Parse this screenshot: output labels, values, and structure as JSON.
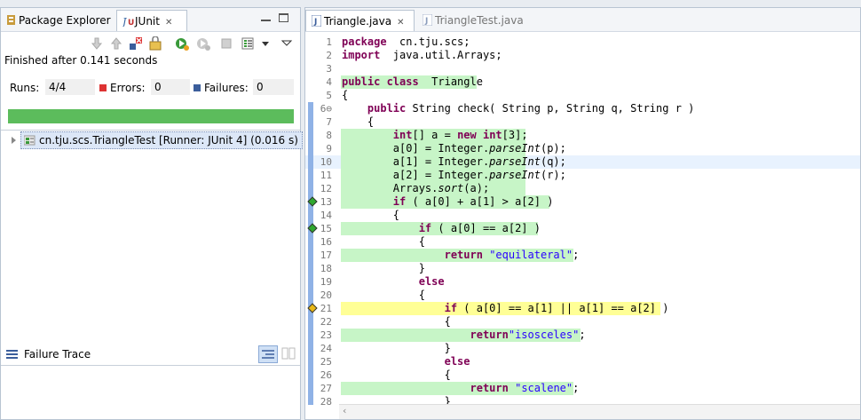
{
  "left_panel": {
    "tabs": [
      {
        "label": "Package Explorer",
        "active": false
      },
      {
        "label": "JUnit",
        "active": true
      }
    ],
    "status_text": "Finished after 0.141 seconds",
    "runs_label": "Runs:",
    "runs_value": "4/4",
    "errors_label": "Errors:",
    "errors_value": "0",
    "failures_label": "Failures:",
    "failures_value": "0",
    "progress_fraction": 1.0,
    "progress_color": "#5cbc5c",
    "test_tree": [
      {
        "label": "cn.tju.scs.TriangleTest [Runner: JUnit 4] (0.016 s)"
      }
    ],
    "failure_trace_label": "Failure Trace"
  },
  "editor": {
    "tabs": [
      {
        "label": "Triangle.java",
        "active": true
      },
      {
        "label": "TriangleTest.java",
        "active": false
      }
    ],
    "coverage_colors": {
      "full": "#c7f5c7",
      "partial": "#ffff96"
    },
    "lines": [
      {
        "n": "1",
        "segs": [
          [
            "kw",
            "package"
          ],
          [
            "",
            "  cn.tju.scs;"
          ]
        ]
      },
      {
        "n": "2",
        "segs": [
          [
            "kw",
            "import"
          ],
          [
            "",
            "  java.util.Arrays;"
          ]
        ]
      },
      {
        "n": "3",
        "segs": []
      },
      {
        "n": "4",
        "cov": "full",
        "covw": 153,
        "segs": [
          [
            "kw",
            "public class"
          ],
          [
            "",
            "  Triangle"
          ]
        ]
      },
      {
        "n": "5",
        "segs": [
          [
            "",
            "{"
          ]
        ]
      },
      {
        "n": "6⊖",
        "ruler": true,
        "segs": [
          [
            "",
            "    "
          ],
          [
            "kw",
            "public"
          ],
          [
            "",
            " String check( String p, String q, String r )"
          ]
        ]
      },
      {
        "n": "7",
        "ruler": true,
        "segs": [
          [
            "",
            "    {"
          ]
        ]
      },
      {
        "n": "8",
        "ruler": true,
        "cov": "full",
        "covw": 208,
        "segs": [
          [
            "",
            "        "
          ],
          [
            "kw",
            "int"
          ],
          [
            "",
            "[] a = "
          ],
          [
            "kw",
            "new"
          ],
          [
            " ",
            " "
          ],
          [
            "kw",
            "int"
          ],
          [
            "",
            "[3];"
          ]
        ]
      },
      {
        "n": "9",
        "ruler": true,
        "cov": "full",
        "covw": 208,
        "segs": [
          [
            "",
            "        a[0] = Integer."
          ],
          [
            "it",
            "parseInt"
          ],
          [
            "",
            "(p);"
          ]
        ]
      },
      {
        "n": "10",
        "ruler": true,
        "cov": "full",
        "covw": 208,
        "current": true,
        "segs": [
          [
            "",
            "        a[1] = Integer."
          ],
          [
            "it",
            "parseInt"
          ],
          [
            "",
            "(q);"
          ]
        ]
      },
      {
        "n": "11",
        "ruler": true,
        "cov": "full",
        "covw": 208,
        "segs": [
          [
            "",
            "        a[2] = Integer."
          ],
          [
            "it",
            "parseInt"
          ],
          [
            "",
            "(r);"
          ]
        ]
      },
      {
        "n": "12",
        "ruler": true,
        "cov": "full",
        "covw": 208,
        "segs": [
          [
            "",
            "        Arrays."
          ],
          [
            "it",
            "sort"
          ],
          [
            "",
            "(a);"
          ]
        ]
      },
      {
        "n": "13",
        "ruler": true,
        "cov": "full",
        "covw": 235,
        "branch": "full",
        "segs": [
          [
            "",
            "        "
          ],
          [
            "kw",
            "if"
          ],
          [
            "",
            " ( a[0] + a[1] > a[2] )"
          ]
        ]
      },
      {
        "n": "14",
        "ruler": true,
        "segs": [
          [
            "",
            "        {"
          ]
        ]
      },
      {
        "n": "15",
        "ruler": true,
        "cov": "full",
        "covw": 222,
        "branch": "full",
        "segs": [
          [
            "",
            "            "
          ],
          [
            "kw",
            "if"
          ],
          [
            "",
            " ( a[0] == a[2] )"
          ]
        ]
      },
      {
        "n": "16",
        "ruler": true,
        "segs": [
          [
            "",
            "            {"
          ]
        ]
      },
      {
        "n": "17",
        "ruler": true,
        "cov": "full",
        "covw": 262,
        "segs": [
          [
            "",
            "                "
          ],
          [
            "kw",
            "return"
          ],
          [
            "",
            " "
          ],
          [
            "str",
            "\"equilateral\""
          ],
          [
            "",
            ";"
          ]
        ]
      },
      {
        "n": "18",
        "ruler": true,
        "segs": [
          [
            "",
            "            }"
          ]
        ]
      },
      {
        "n": "19",
        "ruler": true,
        "segs": [
          [
            "",
            "            "
          ],
          [
            "kw",
            "else"
          ]
        ]
      },
      {
        "n": "20",
        "ruler": true,
        "segs": [
          [
            "",
            "            {"
          ]
        ]
      },
      {
        "n": "21",
        "ruler": true,
        "cov": "partial",
        "covw": 360,
        "branch": "partial",
        "segs": [
          [
            "",
            "                "
          ],
          [
            "kw",
            "if"
          ],
          [
            "",
            " ( a[0] == a[1] || a[1] == a[2] )"
          ]
        ]
      },
      {
        "n": "22",
        "ruler": true,
        "segs": [
          [
            "",
            "                {"
          ]
        ]
      },
      {
        "n": "23",
        "ruler": true,
        "cov": "full",
        "covw": 270,
        "segs": [
          [
            "",
            "                    "
          ],
          [
            "kw",
            "return"
          ],
          [
            "str",
            "\"isosceles\""
          ],
          [
            "",
            ";"
          ]
        ]
      },
      {
        "n": "24",
        "ruler": true,
        "segs": [
          [
            "",
            "                }"
          ]
        ]
      },
      {
        "n": "25",
        "ruler": true,
        "segs": [
          [
            "",
            "                "
          ],
          [
            "kw",
            "else"
          ]
        ]
      },
      {
        "n": "26",
        "ruler": true,
        "segs": [
          [
            "",
            "                {"
          ]
        ]
      },
      {
        "n": "27",
        "ruler": true,
        "cov": "full",
        "covw": 262,
        "segs": [
          [
            "",
            "                    "
          ],
          [
            "kw",
            "return"
          ],
          [
            "",
            " "
          ],
          [
            "str",
            "\"scalene\""
          ],
          [
            "",
            ";"
          ]
        ]
      },
      {
        "n": "28",
        "ruler": true,
        "segs": [
          [
            "",
            "                }"
          ]
        ]
      }
    ]
  }
}
